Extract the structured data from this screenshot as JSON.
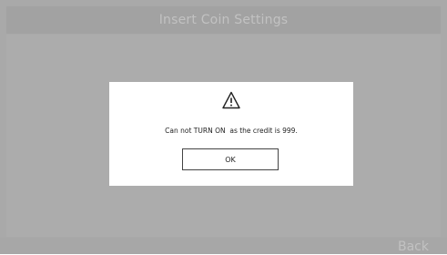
{
  "header": {
    "title": "Insert Coin Settings"
  },
  "dialog": {
    "icon": "warning-icon",
    "message": "Can not TURN ON  as the credit is 999.",
    "ok_label": "OK"
  },
  "footer": {
    "back_label": "Back"
  },
  "colors": {
    "overlay": "#a9a9a9",
    "dialog_background": "#ffffff",
    "dimmed_text": "#c2c2c2"
  }
}
